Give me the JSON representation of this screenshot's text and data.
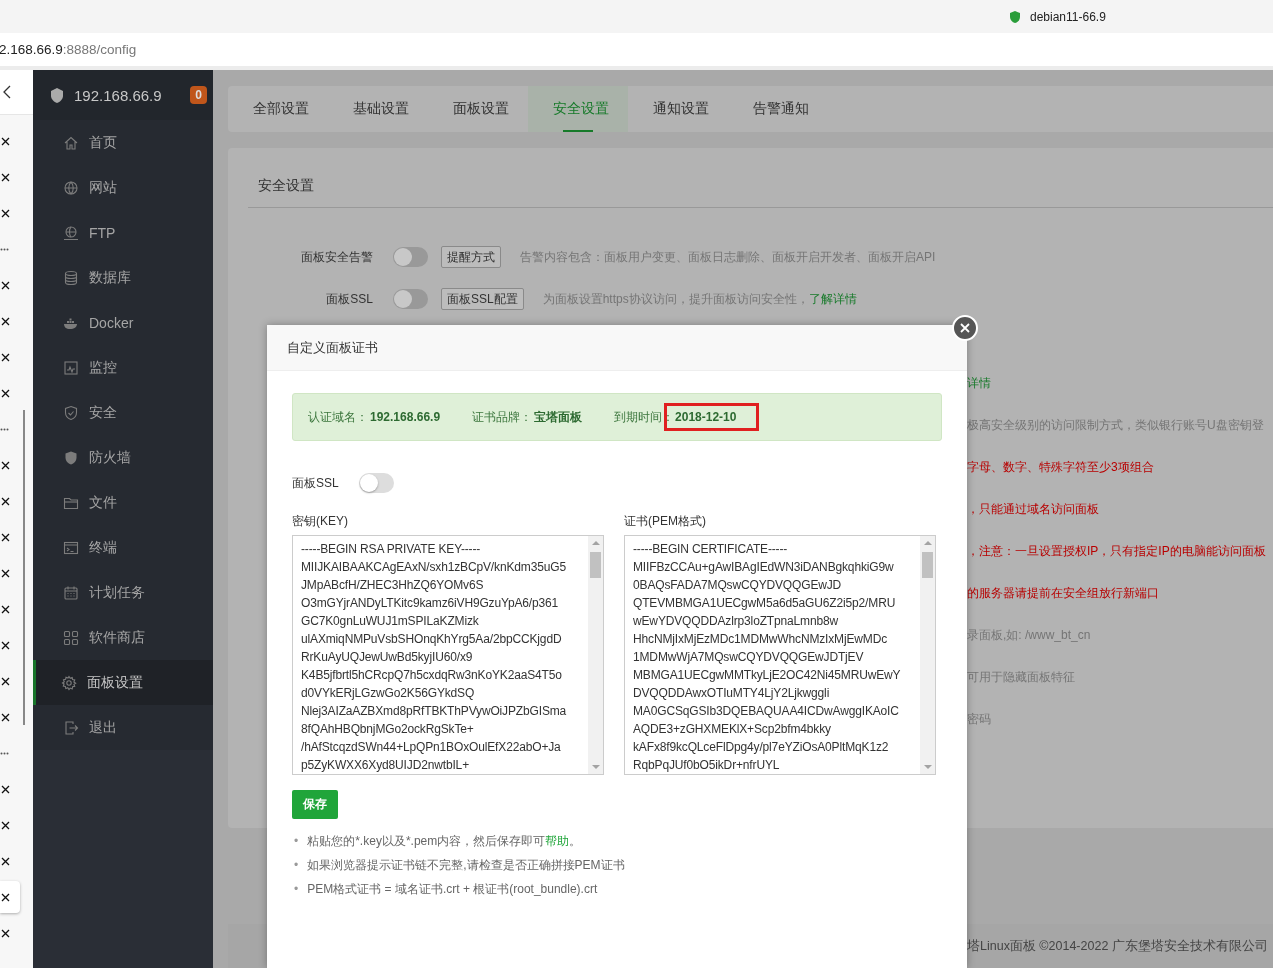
{
  "browser": {
    "tab_title": "debian11-66.9",
    "url_host": "2.168.66.9",
    "url_path": ":8888/config"
  },
  "vertical_tabs": [
    {
      "kind": "close",
      "selected": false
    },
    {
      "kind": "close",
      "selected": false
    },
    {
      "kind": "close",
      "selected": false
    },
    {
      "kind": "more",
      "selected": false
    },
    {
      "kind": "close",
      "selected": false
    },
    {
      "kind": "close",
      "selected": false
    },
    {
      "kind": "close",
      "selected": false
    },
    {
      "kind": "close",
      "selected": false
    },
    {
      "kind": "more",
      "selected": false
    },
    {
      "kind": "close",
      "selected": false
    },
    {
      "kind": "close",
      "selected": false
    },
    {
      "kind": "close",
      "selected": false
    },
    {
      "kind": "close",
      "selected": false
    },
    {
      "kind": "close",
      "selected": false
    },
    {
      "kind": "close",
      "selected": false
    },
    {
      "kind": "close",
      "selected": false
    },
    {
      "kind": "close",
      "selected": false
    },
    {
      "kind": "more",
      "selected": false
    },
    {
      "kind": "close",
      "selected": false
    },
    {
      "kind": "close",
      "selected": false
    },
    {
      "kind": "close",
      "selected": false
    },
    {
      "kind": "close",
      "selected": true
    },
    {
      "kind": "close",
      "selected": false
    }
  ],
  "sidebar": {
    "host": "192.168.66.9",
    "badge": "0",
    "items": [
      {
        "label": "首页",
        "selected": false
      },
      {
        "label": "网站",
        "selected": false
      },
      {
        "label": "FTP",
        "selected": false
      },
      {
        "label": "数据库",
        "selected": false
      },
      {
        "label": "Docker",
        "selected": false
      },
      {
        "label": "监控",
        "selected": false
      },
      {
        "label": "安全",
        "selected": false
      },
      {
        "label": "防火墙",
        "selected": false
      },
      {
        "label": "文件",
        "selected": false
      },
      {
        "label": "终端",
        "selected": false
      },
      {
        "label": "计划任务",
        "selected": false
      },
      {
        "label": "软件商店",
        "selected": false
      },
      {
        "label": "面板设置",
        "selected": true
      },
      {
        "label": "退出",
        "selected": false
      }
    ]
  },
  "tabs": [
    {
      "label": "全部设置",
      "selected": false
    },
    {
      "label": "基础设置",
      "selected": false
    },
    {
      "label": "面板设置",
      "selected": false
    },
    {
      "label": "安全设置",
      "selected": true
    },
    {
      "label": "通知设置",
      "selected": false
    },
    {
      "label": "告警通知",
      "selected": false
    }
  ],
  "card": {
    "title": "安全设置",
    "settings": [
      {
        "label": "面板安全告警",
        "on": false,
        "button": "提醒方式",
        "description": "告警内容包含：面板用户变更、面板日志删除、面板开启开发者、面板开启API"
      },
      {
        "label": "面板SSL",
        "on": false,
        "button": "面板SSL配置",
        "description": "为面板设置https协议访问，提升面板访问安全性，",
        "link": "了解详情"
      }
    ],
    "notes": [
      {
        "text": "详情",
        "kind": "link"
      },
      {
        "text": "极高安全级别的访问限制方式，类似银行账号U盘密钥登",
        "kind": "muted"
      },
      {
        "text": "字母、数字、特殊字符至少3项组合",
        "kind": "warning"
      },
      {
        "text": "，只能通过域名访问面板",
        "kind": "warning"
      },
      {
        "text": "，注意：一旦设置授权IP，只有指定IP的电脑能访问面板",
        "kind": "warning"
      },
      {
        "text": "的服务器请提前在安全组放行新端口",
        "kind": "warning"
      },
      {
        "text": "录面板,如: /www_bt_cn",
        "kind": "muted"
      },
      {
        "text": "可用于隐藏面板特征",
        "kind": "muted"
      },
      {
        "text": "密码",
        "kind": "muted"
      }
    ]
  },
  "footer": "塔Linux面板 ©2014-2022 广东堡塔安全技术有限公司",
  "dialog": {
    "title": "自定义面板证书",
    "info": [
      {
        "label": "认证域名：",
        "value": "192.168.66.9",
        "highlighted": false
      },
      {
        "label": "证书品牌：",
        "value": "宝塔面板",
        "highlighted": false
      },
      {
        "label": "到期时间：",
        "value": "2018-12-10",
        "highlighted": true
      }
    ],
    "ssl_label": "面板SSL",
    "ssl_on": false,
    "fields": [
      {
        "label": "密钥(KEY)",
        "lines": [
          "-----BEGIN RSA PRIVATE KEY-----",
          "MIIJKAIBAAKCAgEAxN/sxh1zBCpV/knKdm35uG5",
          "JMpABcfH/ZHEC3HhZQ6YOMv6S",
          "O3mGYjrANDyLTKitc9kamz6iVH9GzuYpA6/p361",
          "GC7K0gnLuWUJ1mSPILaKZMizk",
          "ulAXmiqNMPuVsbSHOnqKhYrg5Aa/2bpCCKjgdD",
          "RrKuAyUQJewUwBd5kyjIU60/x9",
          "K4B5jfbrtl5hCRcpQ7h5cxdqRw3nKoYK2aaS4T5o",
          "d0VYkERjLGzwGo2K56GYkdSQ",
          "Nlej3AIZaAZBXmd8pRfTBKThPVywOiJPZbGISma",
          "8fQAhHBQbnjMGo2ockRgSkTe+",
          "/hAfStcqzdSWn44+LpQPn1BOxOulEfX22abO+Ja",
          "p5ZyKWXX6Xyd8UIJD2nwtbIL+"
        ]
      },
      {
        "label": "证书(PEM格式)",
        "lines": [
          "-----BEGIN CERTIFICATE-----",
          "MIIFBzCCAu+gAwIBAgIEdWN3iDANBgkqhkiG9w",
          "0BAQsFADA7MQswCQYDVQQGEwJD",
          "QTEVMBMGA1UECgwM5a6d5aGU6Z2i5p2/MRU",
          "wEwYDVQQDDAzlrp3loZTpnaLmnb8w",
          "HhcNMjIxMjEzMDc1MDMwWhcNMzIxMjEwMDc",
          "1MDMwWjA7MQswCQYDVQQGEwJDTjEV",
          "MBMGA1UECgwMMTkyLjE2OC42Ni45MRUwEwY",
          "DVQQDDAwxOTIuMTY4LjY2Ljkwggli",
          "MA0GCSqGSIb3DQEBAQUAA4ICDwAwggIKAoIC",
          "AQDE3+zGHXMEKlX+Scp2bfm4bkky",
          "kAFx8f9kcQLceFlDpg4y/pl7eYZiOsA0PltMqK1z2",
          "RqbPqJUf0bO5ikDr+nfrUYL"
        ]
      }
    ],
    "save": "保存",
    "tips": [
      {
        "marker": "•",
        "text": "粘贴您的*.key以及*.pem内容，然后保存即可",
        "link": "帮助",
        "after": "。"
      },
      {
        "marker": "•",
        "text": "如果浏览器提示证书链不完整,请检查是否正确拼接PEM证书"
      },
      {
        "marker": "•",
        "text": "PEM格式证书 = 域名证书.crt + 根证书(root_bundle).crt"
      }
    ]
  }
}
